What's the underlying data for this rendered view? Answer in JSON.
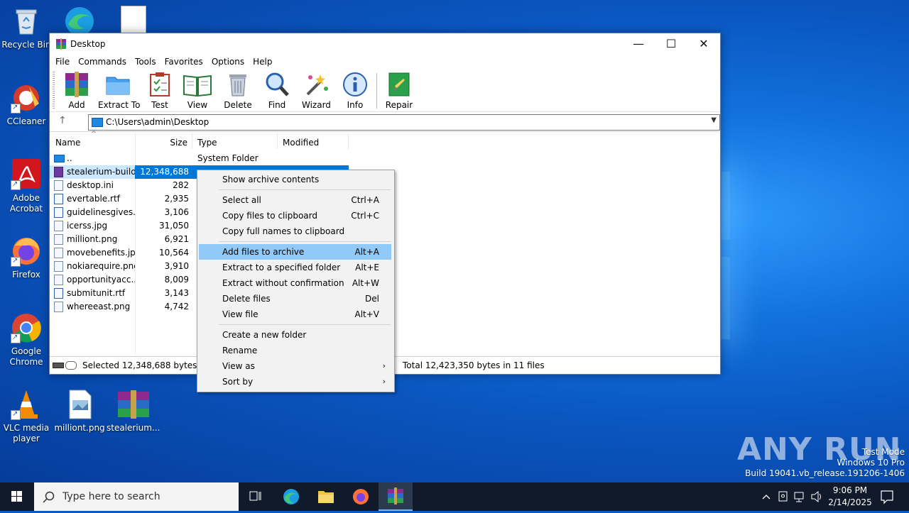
{
  "desktop": {
    "icons": [
      {
        "label": "Recycle Bin"
      },
      {
        "label": "CCleaner"
      },
      {
        "label": "Adobe Acrobat"
      },
      {
        "label": "Firefox"
      },
      {
        "label": "Google Chrome"
      },
      {
        "label": "VLC media player"
      },
      {
        "label": "milliont.png"
      },
      {
        "label": "stealerium..."
      }
    ]
  },
  "window": {
    "title": "Desktop",
    "menu": [
      "File",
      "Commands",
      "Tools",
      "Favorites",
      "Options",
      "Help"
    ],
    "toolbar": [
      "Add",
      "Extract To",
      "Test",
      "View",
      "Delete",
      "Find",
      "Wizard",
      "Info",
      "Repair"
    ],
    "address": "C:\\Users\\admin\\Desktop",
    "columns": {
      "name": "Name",
      "size": "Size",
      "type": "Type",
      "modified": "Modified"
    },
    "files": [
      {
        "name": "..",
        "size": "",
        "type": "System Folder"
      },
      {
        "name": "stealerium-build...",
        "size": "12,348,688",
        "type": ""
      },
      {
        "name": "desktop.ini",
        "size": "282",
        "type": ""
      },
      {
        "name": "evertable.rtf",
        "size": "2,935",
        "type": ""
      },
      {
        "name": "guidelinesgives.rtf",
        "size": "3,106",
        "type": ""
      },
      {
        "name": "icerss.jpg",
        "size": "31,050",
        "type": ""
      },
      {
        "name": "milliont.png",
        "size": "6,921",
        "type": ""
      },
      {
        "name": "movebenefits.jpg",
        "size": "10,564",
        "type": ""
      },
      {
        "name": "nokiarequire.png",
        "size": "3,910",
        "type": ""
      },
      {
        "name": "opportunityacc...",
        "size": "8,009",
        "type": ""
      },
      {
        "name": "submitunit.rtf",
        "size": "3,143",
        "type": ""
      },
      {
        "name": "whereeast.png",
        "size": "4,742",
        "type": ""
      }
    ],
    "status_left": "Selected 12,348,688 bytes in 1 f",
    "status_right": "Total 12,423,350 bytes in 11 files"
  },
  "context_menu": {
    "items": [
      {
        "label": "Show archive contents",
        "key": ""
      },
      {
        "label": "Select all",
        "key": "Ctrl+A"
      },
      {
        "label": "Copy files to clipboard",
        "key": "Ctrl+C"
      },
      {
        "label": "Copy full names to clipboard",
        "key": ""
      },
      {
        "label": "Add files to archive",
        "key": "Alt+A"
      },
      {
        "label": "Extract to a specified folder",
        "key": "Alt+E"
      },
      {
        "label": "Extract without confirmation",
        "key": "Alt+W"
      },
      {
        "label": "Delete files",
        "key": "Del"
      },
      {
        "label": "View file",
        "key": "Alt+V"
      },
      {
        "label": "Create a new folder",
        "key": ""
      },
      {
        "label": "Rename",
        "key": ""
      },
      {
        "label": "View as",
        "key": ""
      },
      {
        "label": "Sort by",
        "key": ""
      }
    ]
  },
  "watermark": {
    "brand": "ANY RUN",
    "line1": "Test Mode",
    "line2": "Windows 10 Pro",
    "line3": "Build 19041.vb_release.191206-1406"
  },
  "taskbar": {
    "search_placeholder": "Type here to search",
    "time": "9:06 PM",
    "date": "2/14/2025"
  },
  "colors": {
    "selection": "#0078d7",
    "menu_highlight": "#91c9f7",
    "taskbar": "#101a2a"
  }
}
